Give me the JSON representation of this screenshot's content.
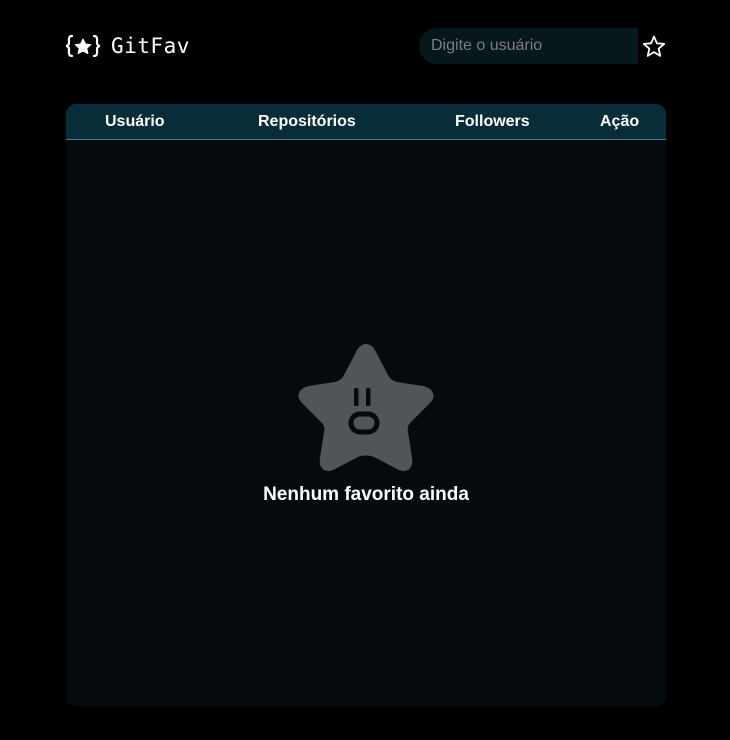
{
  "header": {
    "logo_text": "GitFav",
    "logo_icon": "braces-star-icon",
    "search_placeholder": "Digite o usuário",
    "favorite_button_icon": "star-outline-icon"
  },
  "table": {
    "columns": [
      "Usuário",
      "Repositórios",
      "Followers",
      "Ação"
    ],
    "rows": [],
    "empty_state": {
      "icon": "sad-star-icon",
      "message": "Nenhum favorito ainda"
    }
  },
  "colors": {
    "page_bg": "#000000",
    "table_header_bg": "#092d38",
    "table_body_bg": "#050b0d",
    "search_bg": "#06181c",
    "empty_star": "#4f5559"
  }
}
